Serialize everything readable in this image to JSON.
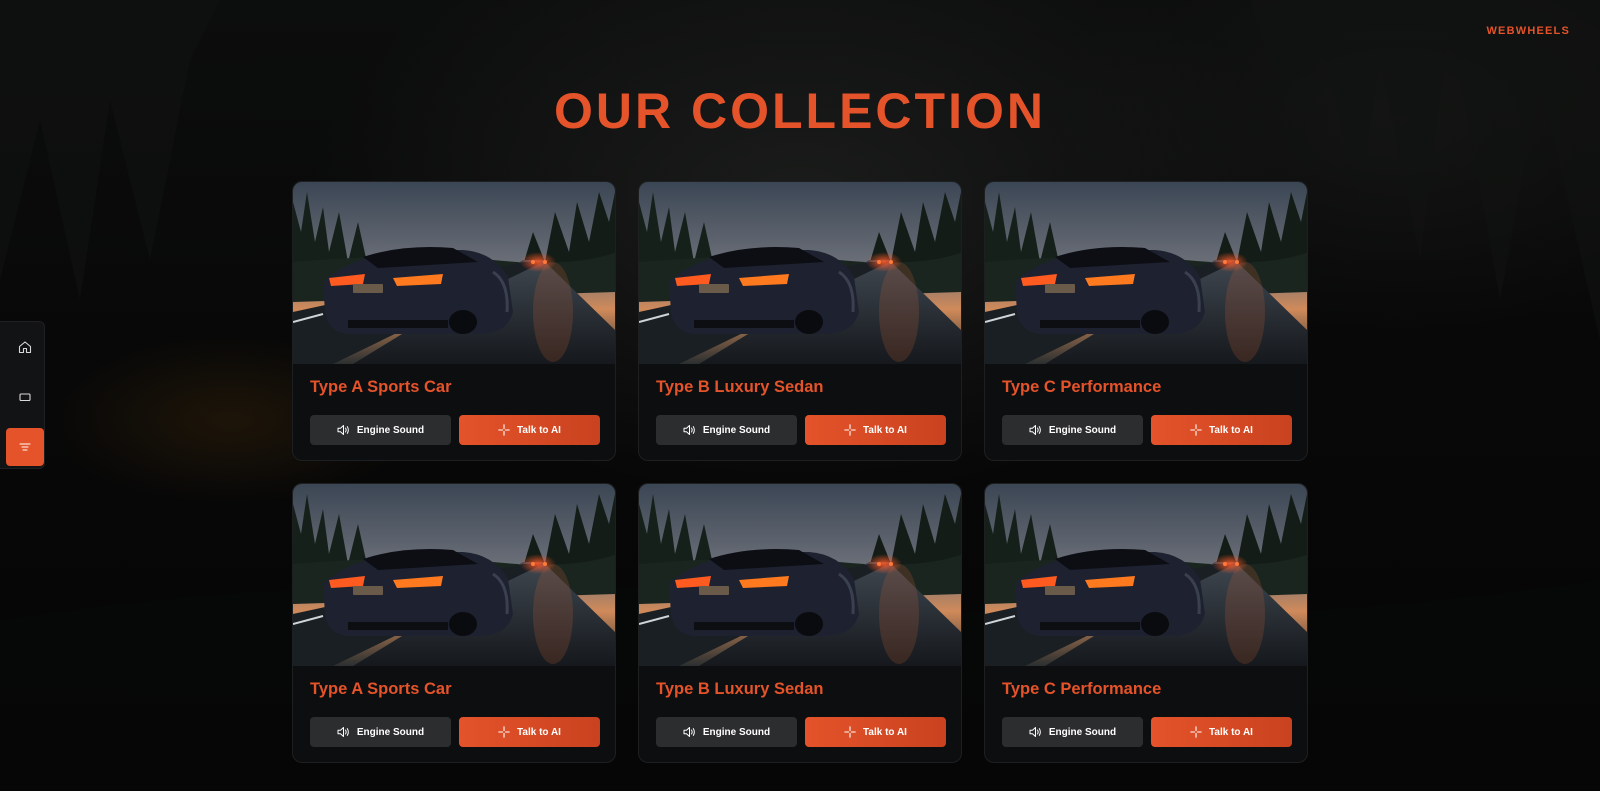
{
  "header": {
    "brand": "WEBWHEELS",
    "title": "OUR COLLECTION"
  },
  "side_nav": {
    "items": [
      {
        "icon": "home-icon",
        "active": false
      },
      {
        "icon": "window-icon",
        "active": false
      },
      {
        "icon": "menu-icon",
        "active": true
      }
    ]
  },
  "cards": [
    {
      "title": "Type A Sports Car",
      "sound_label": "Engine Sound",
      "ai_label": "Talk to AI"
    },
    {
      "title": "Type B Luxury Sedan",
      "sound_label": "Engine Sound",
      "ai_label": "Talk to AI"
    },
    {
      "title": "Type C Performance",
      "sound_label": "Engine Sound",
      "ai_label": "Talk to AI"
    },
    {
      "title": "Type A Sports Car",
      "sound_label": "Engine Sound",
      "ai_label": "Talk to AI"
    },
    {
      "title": "Type B Luxury Sedan",
      "sound_label": "Engine Sound",
      "ai_label": "Talk to AI"
    },
    {
      "title": "Type C Performance",
      "sound_label": "Engine Sound",
      "ai_label": "Talk to AI"
    }
  ],
  "colors": {
    "accent": "#e4532a",
    "card_bg": "#0d0e0f",
    "secondary_button": "#2c2d2f"
  }
}
